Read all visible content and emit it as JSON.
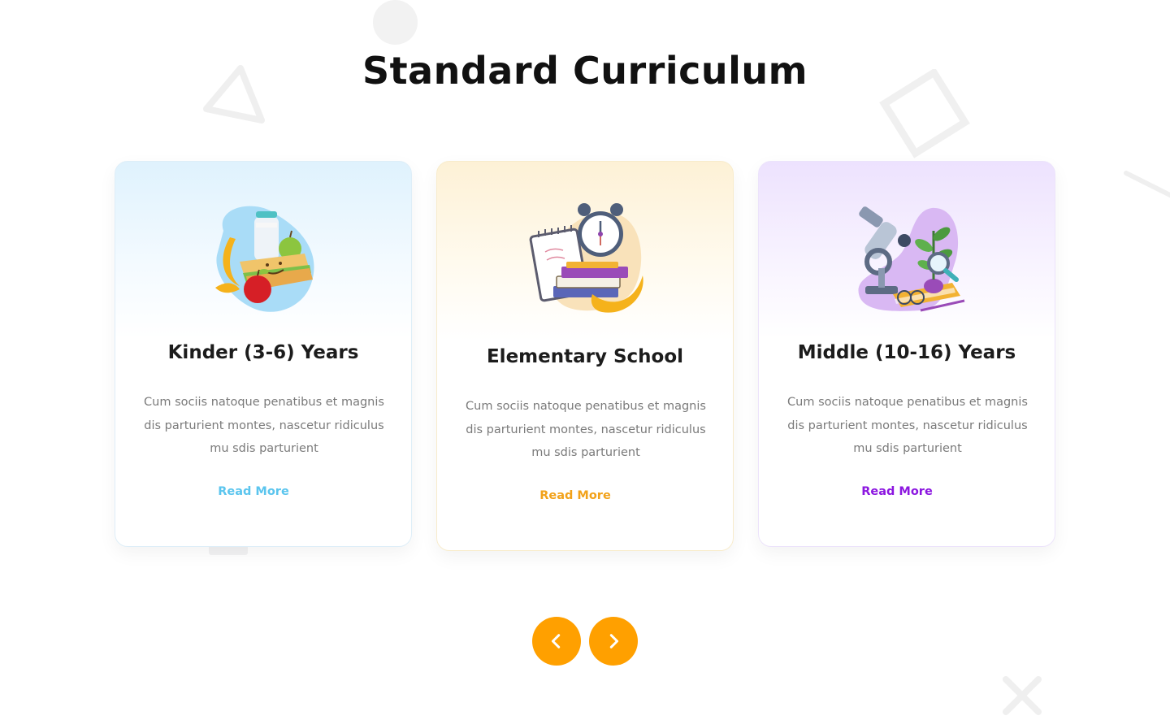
{
  "page": {
    "title": "Standard Curriculum"
  },
  "theme": {
    "accent": "#ffa000",
    "kinder_color": "#5bc5ee",
    "elementary_color": "#f2a21a",
    "middle_color": "#8c17e0"
  },
  "cards": [
    {
      "title": "Kinder (3-6) Years",
      "description": "Cum sociis natoque penatibus et magnis dis parturient montes, nascetur ridiculus mu sdis parturient",
      "link_label": "Read More",
      "icon": "lunch-food-illustration"
    },
    {
      "title": "Elementary School",
      "description": "Cum sociis natoque penatibus et magnis dis parturient montes, nascetur ridiculus mu sdis parturient",
      "link_label": "Read More",
      "icon": "alarm-clock-books-illustration"
    },
    {
      "title": "Middle (10-16) Years",
      "description": "Cum sociis natoque penatibus et magnis dis parturient montes, nascetur ridiculus mu sdis parturient",
      "link_label": "Read More",
      "icon": "microscope-plant-illustration"
    }
  ],
  "carousel": {
    "prev_icon": "chevron-left-icon",
    "next_icon": "chevron-right-icon"
  }
}
